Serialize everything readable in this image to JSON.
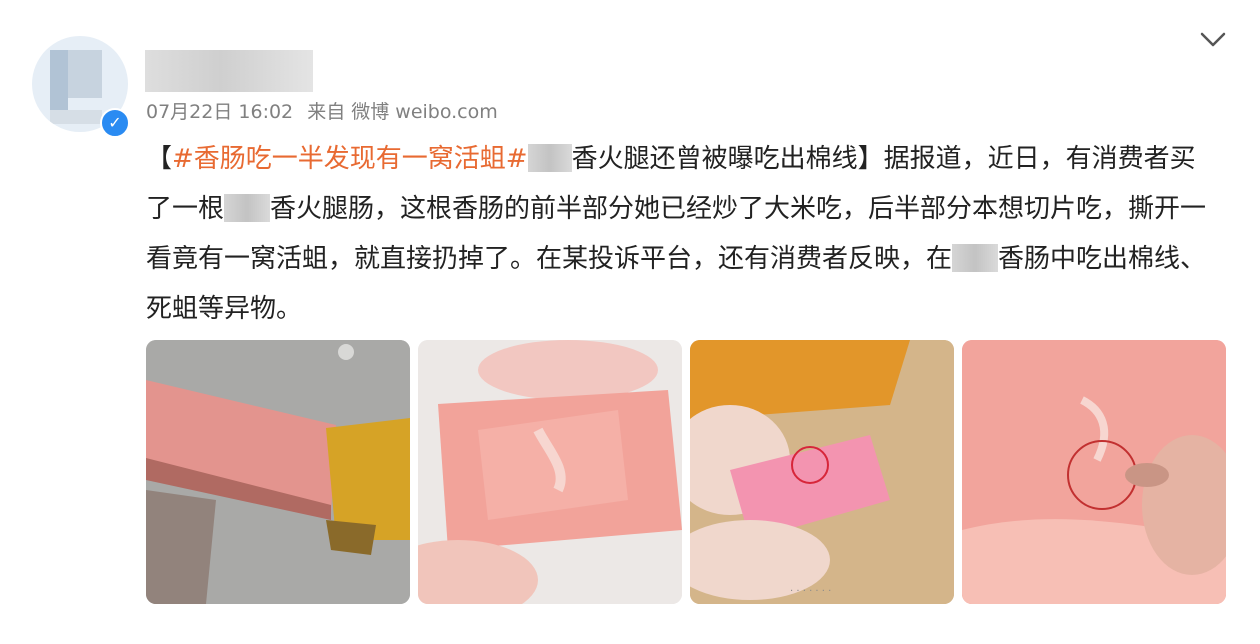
{
  "post": {
    "timestamp": "07月22日 16:02",
    "source": "来自 微博 weibo.com",
    "hashtag": "#香肠吃一半发现有一窝活蛆#",
    "bracket_open": "【",
    "bracket_rest": "香火腿还曾被曝吃出棉线】",
    "text_1": "据报道，近日，有消费者买了一根",
    "text_2": "香火腿肠，这根香肠的前半部分她已经炒了大米吃，后半部分本想切片吃，撕开一看竟有一窝活蛆，就直接扔掉了。在某投诉平台，还有消费者反映，在",
    "text_3": "香肠中吃出棉线、死蛆等异物。"
  },
  "photos": [
    {
      "subject": "sausage-on-steel-tray"
    },
    {
      "subject": "sausage-piece-held"
    },
    {
      "subject": "sausage-block-circled"
    },
    {
      "subject": "sausage-closeup-circled"
    }
  ],
  "icons": {
    "verified": "verified-badge-icon",
    "menu": "chevron-down-icon"
  },
  "colors": {
    "hashtag": "#e86a32",
    "verified": "#2a8bf2",
    "meta": "#808080"
  }
}
